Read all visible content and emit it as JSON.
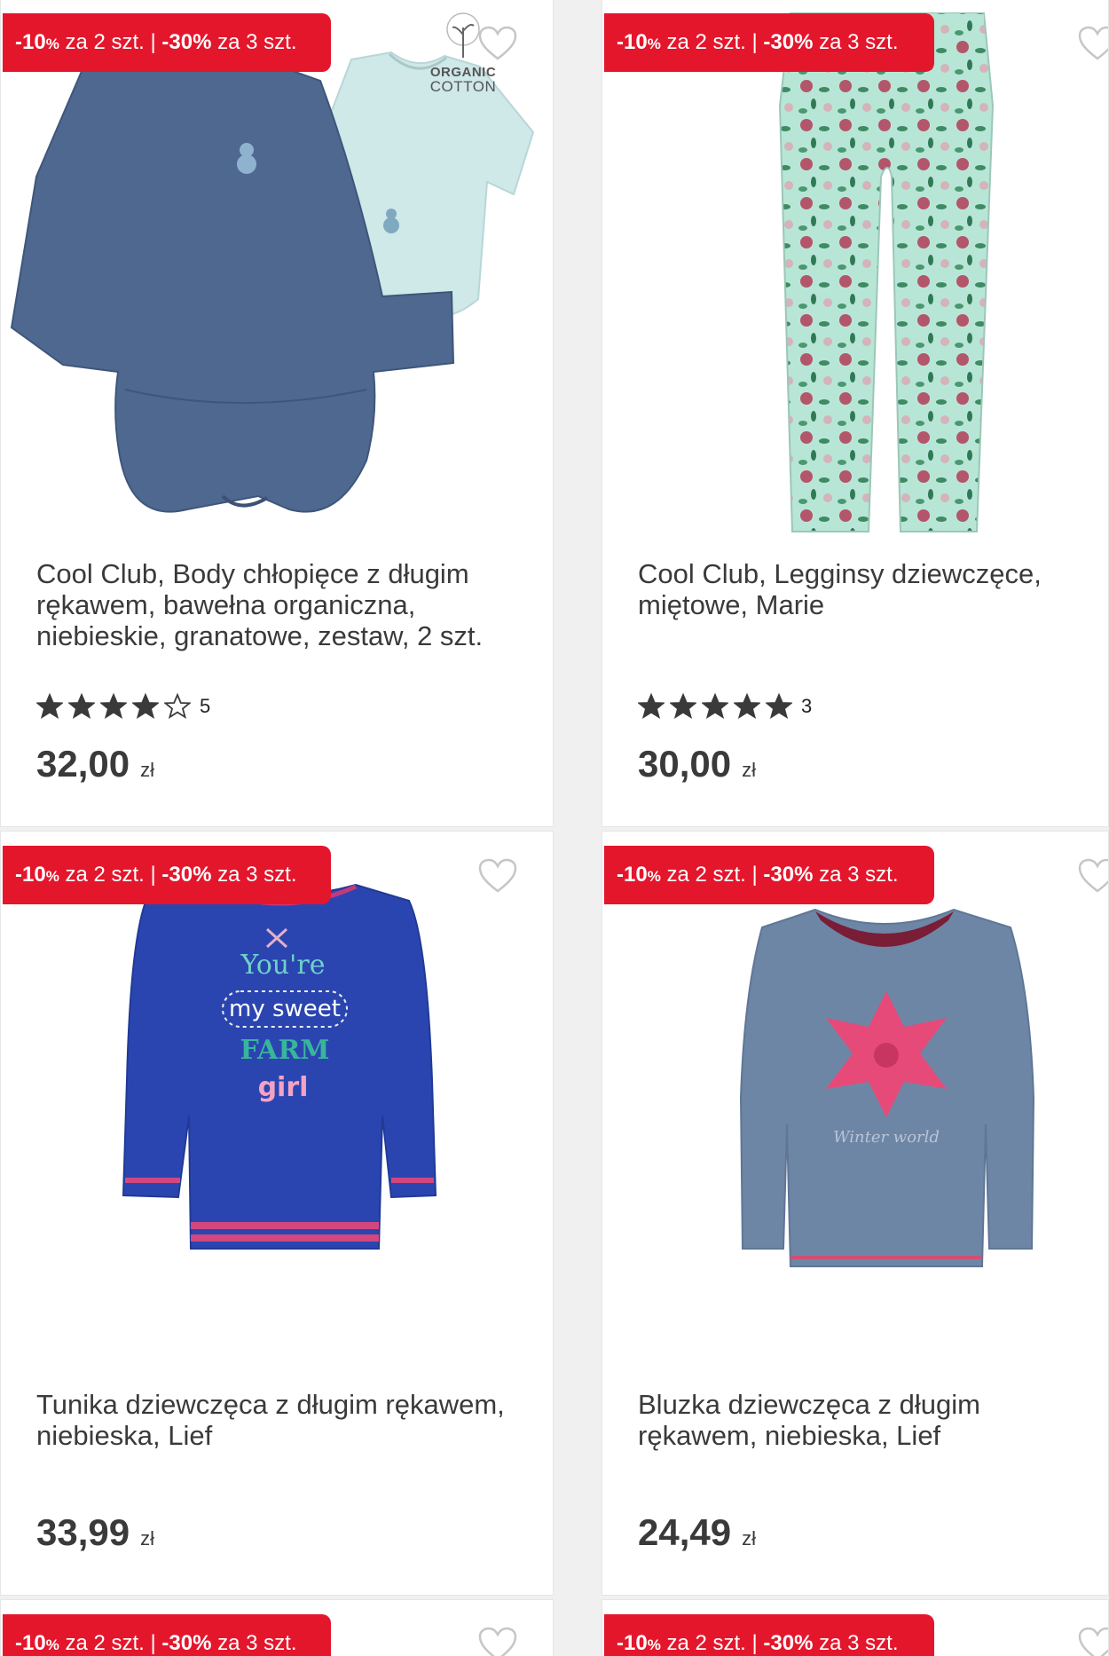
{
  "promo": {
    "p1": "-10",
    "pct": "%",
    "t1": " za 2 szt. | ",
    "p2": "-30%",
    "t2": " za 3 szt."
  },
  "currency": "zł",
  "products": [
    {
      "title": "Cool Club, Body chłopięce z długim rękawem, bawełna organiczna, niebieskie, granatowe, zestaw, 2 szt.",
      "rating": 4,
      "reviews": "5",
      "price": "32,00",
      "badge": {
        "line1": "ORGANIC",
        "line2": "COTTON"
      }
    },
    {
      "title": "Cool Club, Legginsy dziewczęce, miętowe, Marie",
      "rating": 5,
      "reviews": "3",
      "price": "30,00"
    },
    {
      "title": "Tunika dziewczęca z długim rękawem, niebieska, Lief",
      "price": "33,99",
      "print": {
        "l1": "You're",
        "l2": "my sweet",
        "l3": "FARM",
        "l4": "girl"
      }
    },
    {
      "title": "Bluzka dziewczęca z długim rękawem, niebieska, Lief",
      "price": "24,49",
      "print": "Winter world"
    }
  ],
  "colors": {
    "promo_bg": "#e4162c",
    "star": "#3a3a3a"
  },
  "icons": [
    "heart-outline-icon",
    "star-filled-icon",
    "star-outline-icon",
    "organic-cotton-logo"
  ]
}
